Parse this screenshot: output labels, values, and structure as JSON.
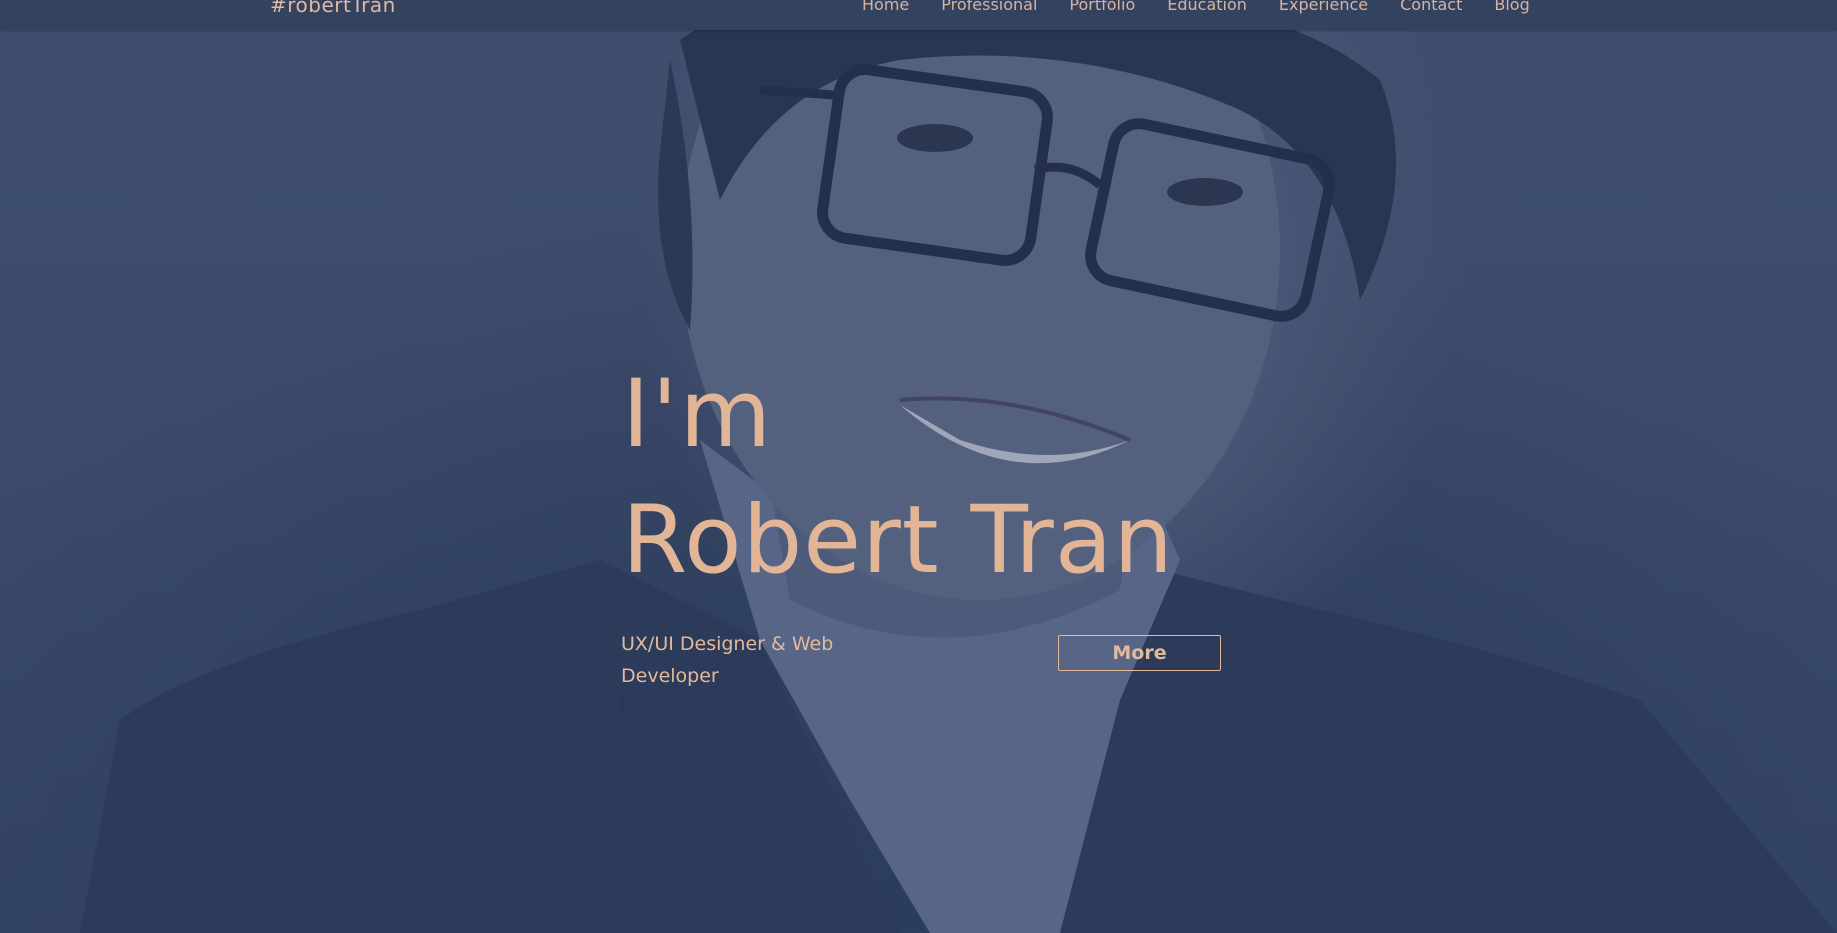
{
  "header": {
    "brand": "#robertTran",
    "nav": [
      {
        "label": "Home"
      },
      {
        "label": "Professional"
      },
      {
        "label": "Portfolio"
      },
      {
        "label": "Education"
      },
      {
        "label": "Experience"
      },
      {
        "label": "Contact"
      },
      {
        "label": "Blog"
      }
    ]
  },
  "hero": {
    "greeting": "I'm",
    "name": "Robert Tran",
    "subtitle": "UX/UI Designer & Web Developer",
    "more_label": "More"
  },
  "colors": {
    "accent": "#e2b597",
    "navbar": "#33425f",
    "overlay": "#2e3e60"
  }
}
